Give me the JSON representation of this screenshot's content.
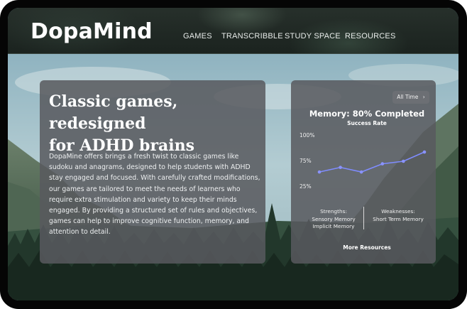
{
  "brand": {
    "logo": "DopaMind"
  },
  "nav": {
    "items": [
      "GAMES",
      "TRANSCRIBBLE",
      "STUDY SPACE",
      "RESOURCES"
    ]
  },
  "intro": {
    "headline_line1": "Classic games, redesigned",
    "headline_line2": "for ADHD brains",
    "body": "DopaMine offers brings a fresh twist to classic games like sudoku and anagrams, designed to help students with ADHD stay engaged and focused. With carefully crafted modifications, our games are tailored to meet the needs of learners who require extra stimulation and variety to keep their minds engaged. By providing a structured set of rules and objectives, games can help to improve cognitive function, memory, and attention to detail."
  },
  "progress": {
    "filter_label": "All Time",
    "title": "Memory: 80% Completed",
    "subtitle": "Success Rate",
    "strengths_label": "Strengths:",
    "strengths": [
      "Sensory Memory",
      "Implicit Memory"
    ],
    "weaknesses_label": "Weaknesses:",
    "weaknesses": [
      "Short Term Memory"
    ],
    "more_label": "More Resources"
  },
  "chart_data": {
    "type": "line",
    "title": "Memory: 80% Completed",
    "subtitle": "Success Rate",
    "y_ticks": [
      "100%",
      "75%",
      "25%"
    ],
    "series": [
      {
        "values": [
          0.29,
          0.38,
          0.29,
          0.45,
          0.5,
          0.68
        ]
      }
    ],
    "grid": false
  },
  "colors": {
    "line": "#7f8cff",
    "point": "#8a93ff",
    "card": "#585a5e"
  }
}
